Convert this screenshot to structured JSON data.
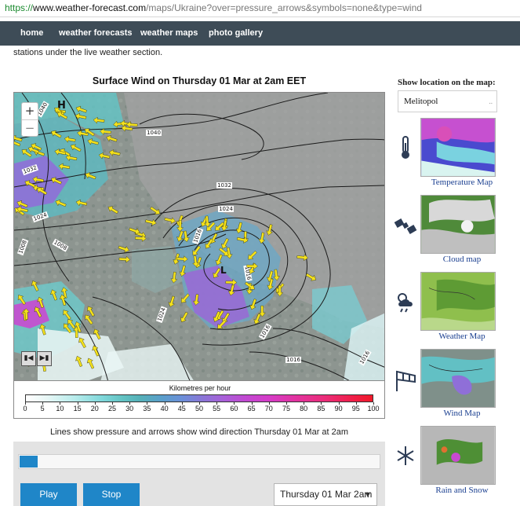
{
  "browser": {
    "url_scheme": "https://",
    "url_host": "www.weather-forecast.com",
    "url_path": "/maps/Ukraine?over=pressure_arrows&symbols=none&type=wind"
  },
  "nav": {
    "items": [
      "home",
      "weather forecasts",
      "weather maps",
      "photo gallery"
    ]
  },
  "intro_text": "stations under the live weather section.",
  "map": {
    "title": "Surface Wind on Thursday 01 Mar at 2am EET",
    "zoom_in": "+",
    "zoom_out": "−",
    "nav_first": "▮◀",
    "nav_next": "▶▮",
    "isobar_labels": [
      "1040",
      "1040",
      "1032",
      "1024",
      "1008",
      "1032",
      "1024",
      "1016",
      "1016",
      "1024",
      "1016",
      "1016",
      "1008",
      "1016"
    ],
    "high_marker": "H",
    "low_marker": "L"
  },
  "legend": {
    "title": "Kilometres per hour",
    "ticks": [
      "0",
      "5",
      "10",
      "15",
      "20",
      "25",
      "30",
      "35",
      "40",
      "45",
      "50",
      "55",
      "60",
      "65",
      "70",
      "75",
      "80",
      "85",
      "90",
      "95",
      "100"
    ]
  },
  "caption": "Lines show pressure and arrows show wind direction Thursday 01 Mar at 2am",
  "controls": {
    "progress_fraction": 0.05,
    "play_label": "Play",
    "stop_label": "Stop",
    "time_selected": "Thursday 01 Mar 2am"
  },
  "sidebar": {
    "title": "Show location on the map:",
    "location_value": "Melitopol",
    "location_dots": "..",
    "cards": [
      {
        "label": "Temperature Map",
        "icon": "thermometer-icon"
      },
      {
        "label": "Cloud map",
        "icon": "satellite-icon"
      },
      {
        "label": "Weather Map",
        "icon": "sun-cloud-rain-icon"
      },
      {
        "label": "Wind Map",
        "icon": "windsock-icon"
      },
      {
        "label": "Rain and Snow",
        "icon": "snowflake-icon"
      }
    ]
  },
  "colors": {
    "nav_bg": "#3e4c57",
    "accent_blue": "#1f86c8",
    "link_blue": "#1a3f90",
    "wind_arrow": "#f5e21c",
    "isobar": "#1a1a1a"
  }
}
